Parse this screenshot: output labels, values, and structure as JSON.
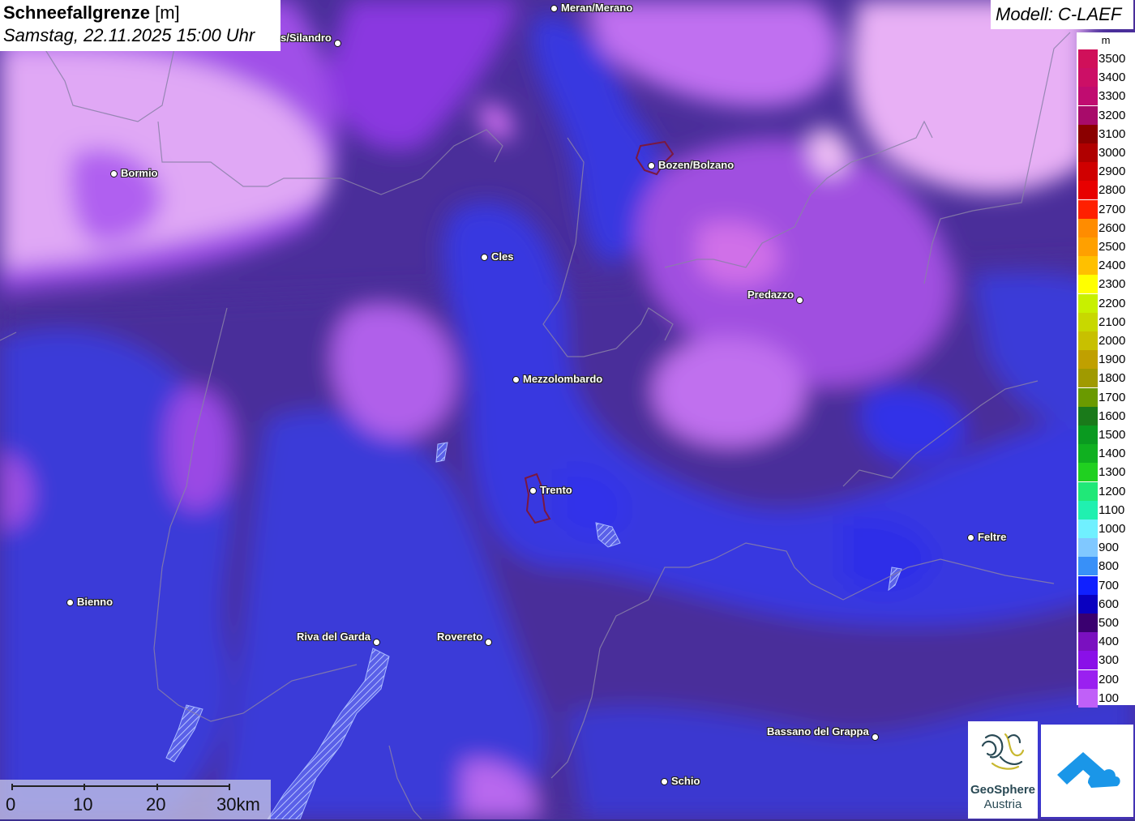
{
  "title": {
    "main": "Schneefallgrenze",
    "unit": "[m]",
    "datetime": "Samstag, 22.11.2025 15:00 Uhr"
  },
  "model": "Modell: C-LAEF",
  "legend": {
    "unit": "m",
    "items": [
      {
        "label": "3500",
        "color": "#d0105a"
      },
      {
        "label": "3400",
        "color": "#cc0f66"
      },
      {
        "label": "3300",
        "color": "#c00c70"
      },
      {
        "label": "3200",
        "color": "#a80b6a"
      },
      {
        "label": "3100",
        "color": "#8b0000"
      },
      {
        "label": "3000",
        "color": "#b00000"
      },
      {
        "label": "2900",
        "color": "#d00000"
      },
      {
        "label": "2800",
        "color": "#e80000"
      },
      {
        "label": "2700",
        "color": "#ff2000"
      },
      {
        "label": "2600",
        "color": "#ff8c00"
      },
      {
        "label": "2500",
        "color": "#ffa000"
      },
      {
        "label": "2400",
        "color": "#ffc000"
      },
      {
        "label": "2300",
        "color": "#ffff00"
      },
      {
        "label": "2200",
        "color": "#c8f000"
      },
      {
        "label": "2100",
        "color": "#c8d800"
      },
      {
        "label": "2000",
        "color": "#c8c000"
      },
      {
        "label": "1900",
        "color": "#c0a000"
      },
      {
        "label": "1800",
        "color": "#a09a00"
      },
      {
        "label": "1700",
        "color": "#6a9a00"
      },
      {
        "label": "1600",
        "color": "#1a7a1a"
      },
      {
        "label": "1500",
        "color": "#0a9a20"
      },
      {
        "label": "1400",
        "color": "#10b020"
      },
      {
        "label": "1300",
        "color": "#20d020"
      },
      {
        "label": "1200",
        "color": "#20e878"
      },
      {
        "label": "1100",
        "color": "#20f0b0"
      },
      {
        "label": "1000",
        "color": "#70f0ff"
      },
      {
        "label": "900",
        "color": "#80c8ff"
      },
      {
        "label": "800",
        "color": "#3890f8"
      },
      {
        "label": "700",
        "color": "#1020ff"
      },
      {
        "label": "600",
        "color": "#0a00c0"
      },
      {
        "label": "500",
        "color": "#3a0070"
      },
      {
        "label": "400",
        "color": "#7a10c0"
      },
      {
        "label": "300",
        "color": "#8a10e8"
      },
      {
        "label": "200",
        "color": "#9a20f0"
      },
      {
        "label": "100",
        "color": "#c060f8"
      }
    ]
  },
  "cities": [
    {
      "name": "Meran/Merano",
      "label_side": "right"
    },
    {
      "name": "s/Silandro",
      "label_side": "left"
    },
    {
      "name": "Bormio",
      "label_side": "right"
    },
    {
      "name": "Bozen/Bolzano",
      "label_side": "right"
    },
    {
      "name": "Cles",
      "label_side": "right"
    },
    {
      "name": "Predazzo",
      "label_side": "left"
    },
    {
      "name": "Mezzolombardo",
      "label_side": "right"
    },
    {
      "name": "Trento",
      "label_side": "right"
    },
    {
      "name": "Feltre",
      "label_side": "right"
    },
    {
      "name": "Bienno",
      "label_side": "right"
    },
    {
      "name": "Riva del Garda",
      "label_side": "left"
    },
    {
      "name": "Rovereto",
      "label_side": "left"
    },
    {
      "name": "Bassano del Grappa",
      "label_side": "left"
    },
    {
      "name": "Schio",
      "label_side": "right"
    }
  ],
  "scalebar": {
    "labels": [
      "0",
      "10",
      "20",
      "30km"
    ]
  },
  "logos": {
    "geosphere_line1": "GeoSphere",
    "geosphere_line2": "Austria"
  }
}
